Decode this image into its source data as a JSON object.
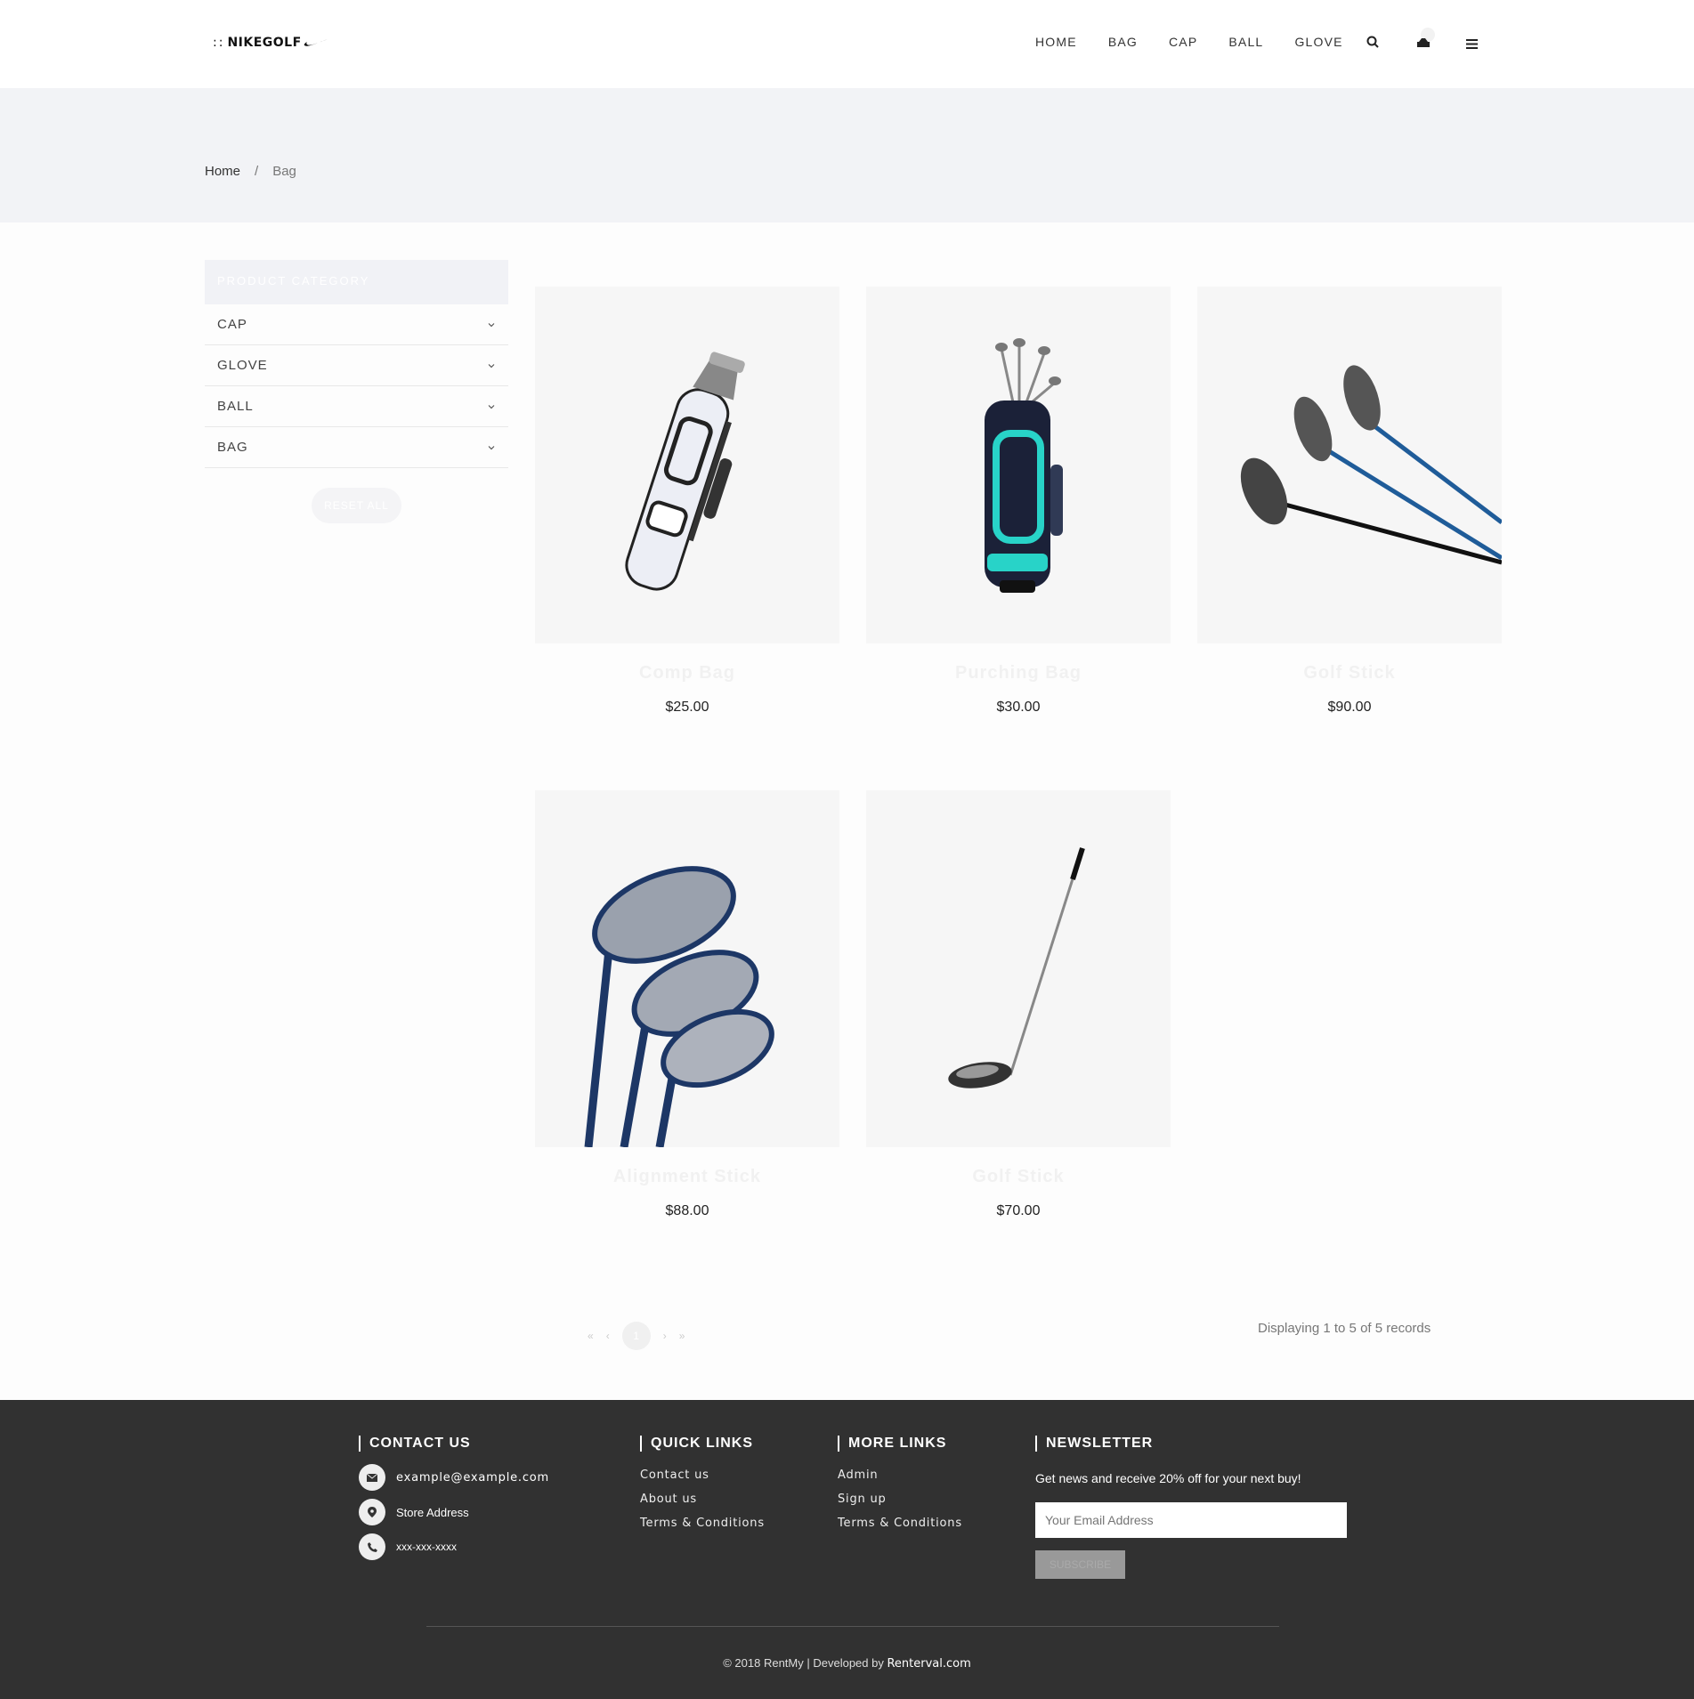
{
  "brand": {
    "logo_dots": "::",
    "logo_text": "NIKEGOLF"
  },
  "nav": {
    "items": [
      "HOME",
      "BAG",
      "CAP",
      "BALL",
      "GLOVE"
    ],
    "search_icon": "search-icon",
    "cart_icon": "cart-icon",
    "menu_icon": "hamburger-icon"
  },
  "breadcrumb": {
    "home": "Home",
    "separator": "/",
    "current": "Bag"
  },
  "sidebar": {
    "title": "PRODUCT CATEGORY",
    "categories": [
      "CAP",
      "GLOVE",
      "BALL",
      "BAG"
    ],
    "reset_label": "RESET ALL"
  },
  "products": [
    {
      "name": "Comp Bag",
      "price": "$25.00"
    },
    {
      "name": "Purching Bag",
      "price": "$30.00"
    },
    {
      "name": "Golf Stick",
      "price": "$90.00"
    },
    {
      "name": "Alignment Stick",
      "price": "$88.00"
    },
    {
      "name": "Golf Stick",
      "price": "$70.00"
    }
  ],
  "pagination": {
    "first": "«",
    "prev": "‹",
    "current": "1",
    "next": "›",
    "last": "»",
    "records_text": "Displaying 1 to 5 of 5 records"
  },
  "footer": {
    "contact": {
      "title": "CONTACT US",
      "email": "example@example.com",
      "address": "Store Address",
      "phone": "xxx-xxx-xxxx"
    },
    "quick_links": {
      "title": "QUICK LINKS",
      "items": [
        "Contact us",
        "About us",
        "Terms & Conditions"
      ]
    },
    "more_links": {
      "title": "MORE LINKS",
      "items": [
        "Admin",
        "Sign up",
        "Terms & Conditions"
      ]
    },
    "newsletter": {
      "title": "NEWSLETTER",
      "text": "Get news and receive 20% off for your next buy!",
      "placeholder": "Your Email Address",
      "button": "SUBSCRIBE"
    },
    "copyright": "© 2018 RentMy | Developed by ",
    "developer": "Renterval.com"
  },
  "colors": {
    "footer_bg": "#313131",
    "band_bg": "#f2f3f6",
    "card_bg": "#f6f6f6"
  }
}
